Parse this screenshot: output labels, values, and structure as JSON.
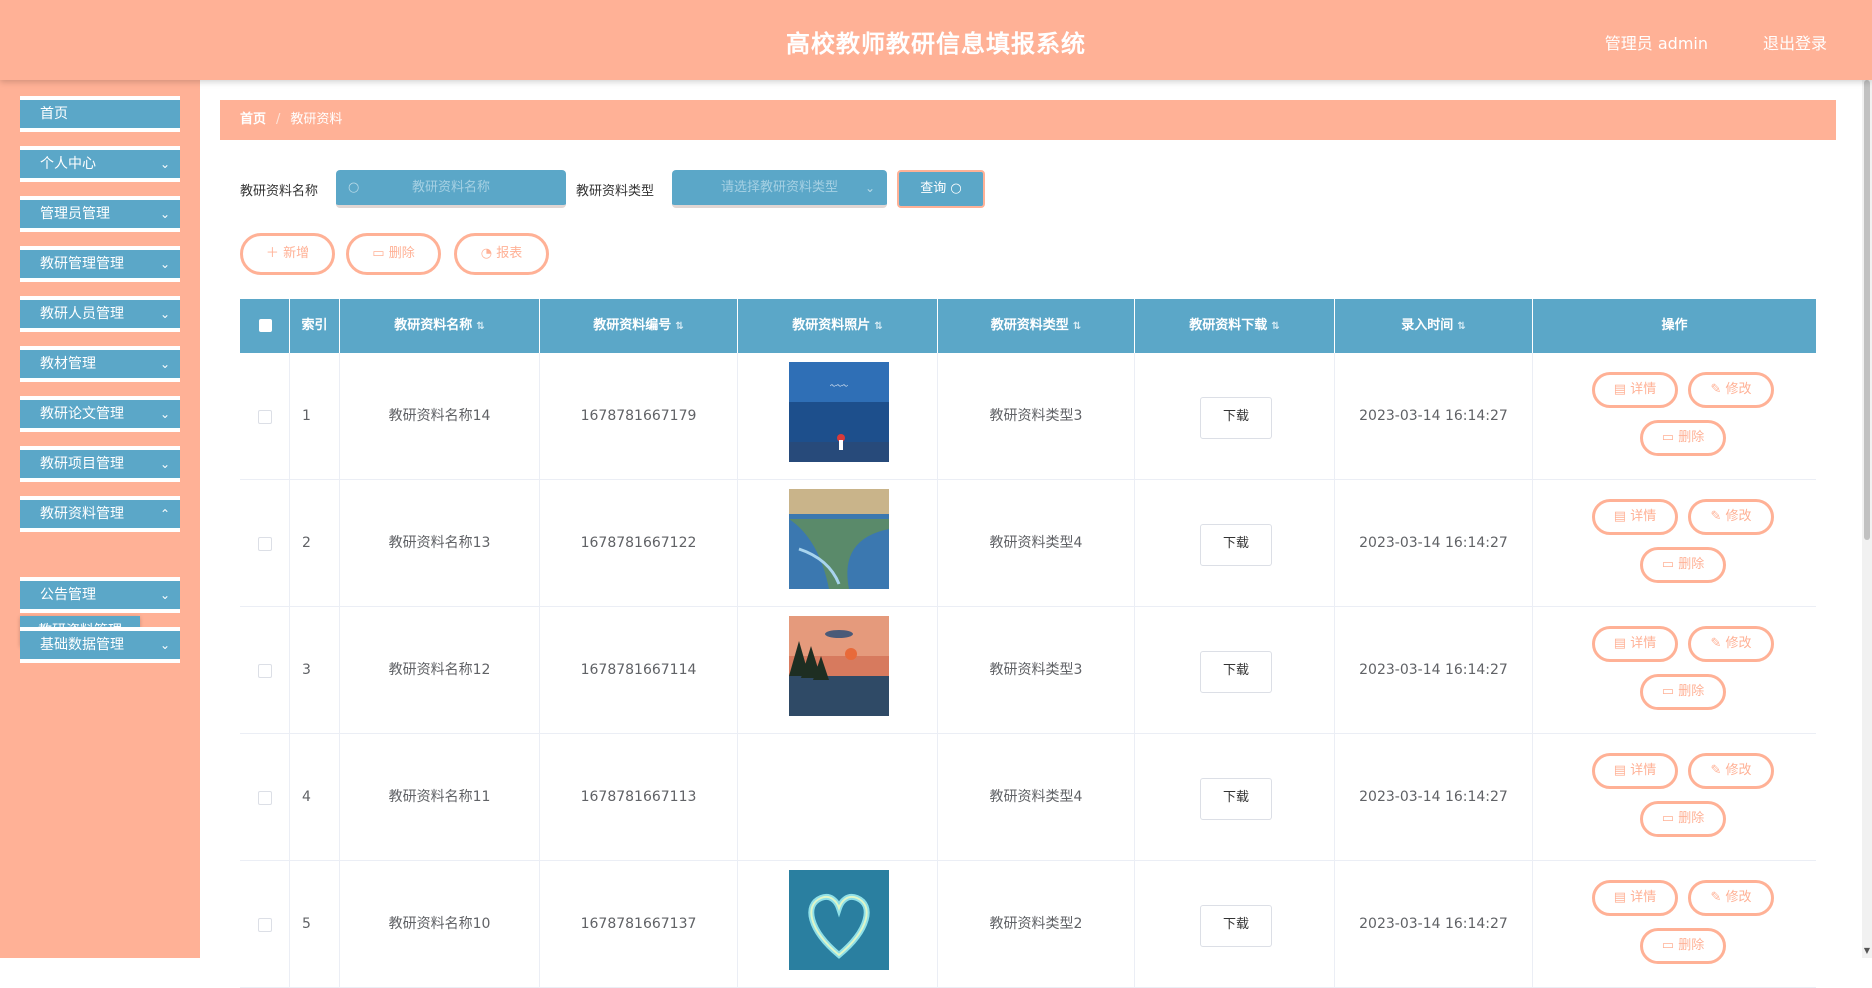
{
  "header": {
    "title": "高校教师教研信息填报系统",
    "user": "管理员 admin",
    "logout": "退出登录"
  },
  "sidebar": {
    "items": [
      {
        "label": "首页"
      },
      {
        "label": "个人中心"
      },
      {
        "label": "管理员管理"
      },
      {
        "label": "教研管理管理"
      },
      {
        "label": "教研人员管理"
      },
      {
        "label": "教材管理"
      },
      {
        "label": "教研论文管理"
      },
      {
        "label": "教研项目管理"
      },
      {
        "label": "教研资料管理"
      },
      {
        "label": "公告管理"
      },
      {
        "label": "基础数据管理"
      }
    ],
    "submenu": "教研资料管理"
  },
  "breadcrumb": {
    "home": "首页",
    "current": "教研资料"
  },
  "search": {
    "name_label": "教研资料名称",
    "name_placeholder": "教研资料名称",
    "type_label": "教研资料类型",
    "type_placeholder": "请选择教研资料类型",
    "query": "查询"
  },
  "actions": {
    "add": "新增",
    "delete": "删除",
    "report": "报表"
  },
  "table": {
    "headers": [
      "索引",
      "教研资料名称",
      "教研资料编号",
      "教研资料照片",
      "教研资料类型",
      "教研资料下载",
      "录入时间",
      "操作"
    ],
    "rows": [
      {
        "index": "1",
        "name": "教研资料名称14",
        "code": "1678781667179",
        "type": "教研资料类型3",
        "download": "下载",
        "time": "2023-03-14 16:14:27"
      },
      {
        "index": "2",
        "name": "教研资料名称13",
        "code": "1678781667122",
        "type": "教研资料类型4",
        "download": "下载",
        "time": "2023-03-14 16:14:27"
      },
      {
        "index": "3",
        "name": "教研资料名称12",
        "code": "1678781667114",
        "type": "教研资料类型3",
        "download": "下载",
        "time": "2023-03-14 16:14:27"
      },
      {
        "index": "4",
        "name": "教研资料名称11",
        "code": "1678781667113",
        "type": "教研资料类型4",
        "download": "下载",
        "time": "2023-03-14 16:14:27"
      },
      {
        "index": "5",
        "name": "教研资料名称10",
        "code": "1678781667137",
        "type": "教研资料类型2",
        "download": "下载",
        "time": "2023-03-14 16:14:27"
      }
    ],
    "op": {
      "detail": "详情",
      "edit": "修改",
      "delete": "删除"
    }
  },
  "colors": {
    "header": "#ffb196",
    "accent": "#5ba7c8"
  }
}
